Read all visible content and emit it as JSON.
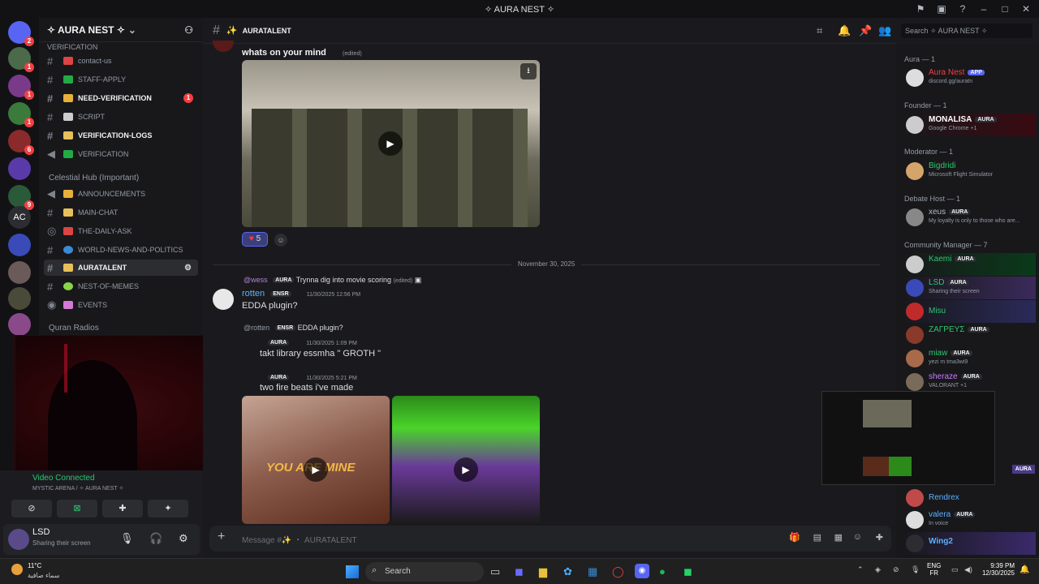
{
  "window": {
    "title": "✧ AURA NEST ✧"
  },
  "server_badges": [
    "2",
    "1",
    "1",
    "1",
    "6",
    "9"
  ],
  "server_ac_label": "AC",
  "guild": {
    "name": "✧ AURA NEST ✧"
  },
  "categories": {
    "verification": "VERIFICATION",
    "celestial": "Celestial Hub (Important)",
    "quran": "Quran Radios"
  },
  "channels": [
    {
      "label": "contact-us",
      "bold": false,
      "count": ""
    },
    {
      "label": "STAFF-APPLY",
      "bold": false,
      "count": ""
    },
    {
      "label": "NEED-VERIFICATION",
      "bold": true,
      "count": "1"
    },
    {
      "label": "SCRIPT",
      "bold": false,
      "count": ""
    },
    {
      "label": "VERIFICATION-LOGS",
      "bold": true,
      "count": ""
    },
    {
      "label": "VERIFICATION",
      "bold": false,
      "count": ""
    },
    {
      "label": "ANNOUNCEMENTS",
      "bold": false,
      "count": ""
    },
    {
      "label": "MAIN-CHAT",
      "bold": false,
      "count": ""
    },
    {
      "label": "THE-DAILY-ASK",
      "bold": false,
      "count": ""
    },
    {
      "label": "WORLD-NEWS-AND-POLITICS",
      "bold": false,
      "count": ""
    },
    {
      "label": "AURATALENT",
      "bold": true,
      "count": ""
    },
    {
      "label": "NEST-OF-MEMES",
      "bold": false,
      "count": ""
    },
    {
      "label": "EVENTS",
      "bold": false,
      "count": ""
    }
  ],
  "voice": {
    "status": "Video Connected",
    "location": "MYSTIC ARENA / ✧ AURA NEST ✧"
  },
  "user": {
    "name": "LSD",
    "status": "Sharing their screen"
  },
  "chat_header": {
    "channel": "AURATALENT",
    "search_placeholder": "Search ✧ AURA NEST ✧"
  },
  "messages": {
    "m1_text": "whats on your mind",
    "m1_edited": "(edited)",
    "reaction_count": "5",
    "divider": "November 30, 2025",
    "reply1_user": "@wess",
    "reply1_tag": "AURA",
    "reply1_text": "Trynna dig into movie scoring",
    "reply1_edited": "(edited)",
    "m2_user": "rotten",
    "m2_tag": "ENSR",
    "m2_time": "11/30/2025 12:56 PM",
    "m2_text": "EDDA plugin?",
    "reply2_user": "@rotten",
    "reply2_tag": "ENSR",
    "reply2_text": "EDDA plugin?",
    "m3_tag": "AURA",
    "m3_time": "11/30/2025 1:09 PM",
    "m3_text": "takt library essmha \" GROTH \"",
    "m4_tag": "AURA",
    "m4_time": "11/30/2025 5:21 PM",
    "m4_text": "two fire beats i've made",
    "vid1_caption": "YOU ARE MINE",
    "composer_placeholder": "Message #✨ ・ AURATALENT"
  },
  "members": {
    "groups": [
      {
        "label": "Aura — 1"
      },
      {
        "label": "Founder — 1"
      },
      {
        "label": "Moderator — 1"
      },
      {
        "label": "Debate Host — 1"
      },
      {
        "label": "Community Manager — 7"
      }
    ],
    "list": [
      {
        "name": "Aura Nest",
        "tag": "APP",
        "status": "discord.gg/auratn",
        "color": "#f23f42"
      },
      {
        "name": "MONALISA",
        "tag": "AURA",
        "status": "Google Chrome +1",
        "color": "#ffffff"
      },
      {
        "name": "Bigdridi",
        "tag": "",
        "status": "Microsoft Flight Simulator",
        "color": "#2dc770"
      },
      {
        "name": "xeus",
        "tag": "AURA",
        "status": "My loyalty is only to those who are...",
        "color": "#b5bac1"
      },
      {
        "name": "Kaemi",
        "tag": "AURA",
        "status": "",
        "color": "#2dc770"
      },
      {
        "name": "LSD",
        "tag": "AURA",
        "status": "Sharing their screen",
        "color": "#2dc770"
      },
      {
        "name": "Misu",
        "tag": "",
        "status": "",
        "color": "#2dc770"
      },
      {
        "name": "ΖΑΓΡΕΥΣ",
        "tag": "AURA",
        "status": "",
        "color": "#2dc770"
      },
      {
        "name": "miaw",
        "tag": "AURA",
        "status": "yezi m tma3wi9",
        "color": "#2dc770"
      },
      {
        "name": "sheraze",
        "tag": "AURA",
        "status": "VALORANT +1",
        "color": "#c77dff"
      },
      {
        "name": "Rendrex",
        "tag": "",
        "status": "",
        "color": "#5ab1ff"
      },
      {
        "name": "valera",
        "tag": "AURA",
        "status": "In voice",
        "color": "#5ab1ff"
      },
      {
        "name": "Wing2",
        "tag": "",
        "status": "",
        "color": "#5ab1ff"
      }
    ]
  },
  "taskbar": {
    "weather_temp": "11°C",
    "weather_desc": "سماء صافية",
    "search": "Search",
    "lang1": "ENG",
    "lang2": "FR",
    "time": "9:39 PM",
    "date": "12/30/2025"
  },
  "pip_tag": "AURA"
}
